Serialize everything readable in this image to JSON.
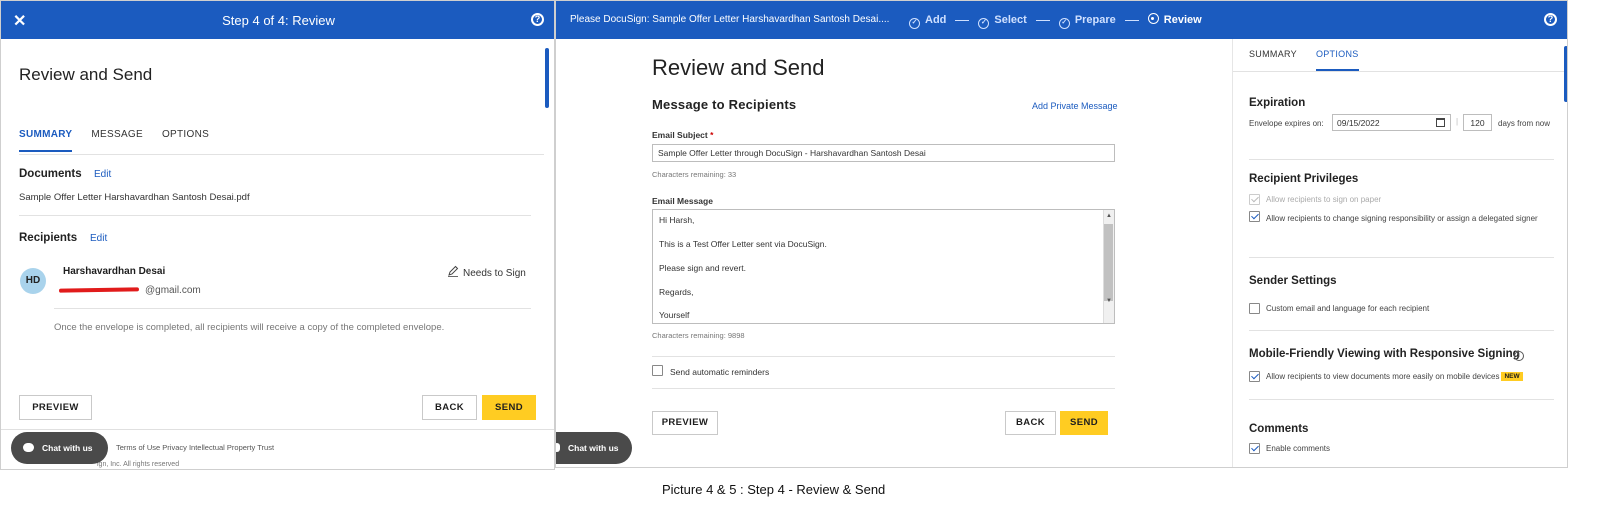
{
  "left": {
    "header": {
      "close_icon": "close-icon",
      "title": "Step 4 of 4: Review",
      "help_icon": "help-icon"
    },
    "heading": "Review and Send",
    "tabs": [
      {
        "label": "SUMMARY",
        "active": true
      },
      {
        "label": "MESSAGE",
        "active": false
      },
      {
        "label": "OPTIONS",
        "active": false
      }
    ],
    "documents": {
      "label": "Documents",
      "edit": "Edit",
      "file": "Sample Offer Letter Harshavardhan Santosh Desai.pdf"
    },
    "recipients": {
      "label": "Recipients",
      "edit": "Edit",
      "items": [
        {
          "initials": "HD",
          "name": "Harshavardhan Desai",
          "email_visible": "@gmail.com",
          "role": "Needs to Sign",
          "role_icon": "pen-icon"
        }
      ],
      "note": "Once the envelope is completed, all recipients will receive a copy of the completed envelope."
    },
    "buttons": {
      "preview": "PREVIEW",
      "back": "BACK",
      "send": "SEND"
    },
    "footer": {
      "links": [
        "Terms of Use",
        "Privacy",
        "Intellectual Property",
        "Trust"
      ],
      "copyright": "ign, Inc. All rights reserved"
    },
    "chat_label": "Chat with us"
  },
  "right": {
    "header": {
      "envelope_title": "Please DocuSign: Sample Offer Letter Harshavardhan Santosh Desai....",
      "steps": [
        {
          "label": "Add",
          "state": "done"
        },
        {
          "label": "Select",
          "state": "done"
        },
        {
          "label": "Prepare",
          "state": "done"
        },
        {
          "label": "Review",
          "state": "current"
        }
      ],
      "help_icon": "help-icon"
    },
    "heading": "Review and Send",
    "section_title": "Message to Recipients",
    "add_private_message": "Add Private Message",
    "email_subject": {
      "label": "Email Subject",
      "required_mark": "*",
      "value": "Sample Offer Letter through DocuSign - Harshavardhan Santosh Desai",
      "remaining": "Characters remaining: 33"
    },
    "email_message": {
      "label": "Email Message",
      "lines": [
        "Hi Harsh,",
        "This is a Test Offer Letter sent via DocuSign.",
        "Please sign and revert.",
        "Regards,",
        "Yourself"
      ],
      "remaining": "Characters remaining: 9898"
    },
    "reminders": {
      "label": "Send automatic reminders",
      "checked": false
    },
    "buttons": {
      "preview": "PREVIEW",
      "back": "BACK",
      "send": "SEND"
    },
    "chat_label": "Chat with us",
    "panel": {
      "tabs": [
        {
          "label": "SUMMARY",
          "active": false
        },
        {
          "label": "OPTIONS",
          "active": true
        }
      ],
      "expiration": {
        "title": "Expiration",
        "label": "Envelope expires on:",
        "date": "09/15/2022",
        "days": "120",
        "suffix": "days from now"
      },
      "privileges": {
        "title": "Recipient Privileges",
        "items": [
          {
            "label": "Allow recipients to sign on paper",
            "checked": true,
            "disabled": true
          },
          {
            "label": "Allow recipients to change signing responsibility or assign a delegated signer",
            "checked": true,
            "disabled": false
          }
        ]
      },
      "sender": {
        "title": "Sender Settings",
        "items": [
          {
            "label": "Custom email and language for each recipient",
            "checked": false
          }
        ]
      },
      "mobile": {
        "title": "Mobile-Friendly Viewing with Responsive Signing",
        "items": [
          {
            "label": "Allow recipients to view documents more easily on mobile devices",
            "checked": true,
            "badge": "NEW"
          }
        ]
      },
      "comments": {
        "title": "Comments",
        "items": [
          {
            "label": "Enable comments",
            "checked": true
          }
        ]
      }
    }
  },
  "caption": "Picture 4 & 5 : Step 4 - Review & Send",
  "colors": {
    "brand_blue": "#1b5bbf",
    "send_yellow": "#ffcc22",
    "redaction_red": "#e11b1b"
  }
}
